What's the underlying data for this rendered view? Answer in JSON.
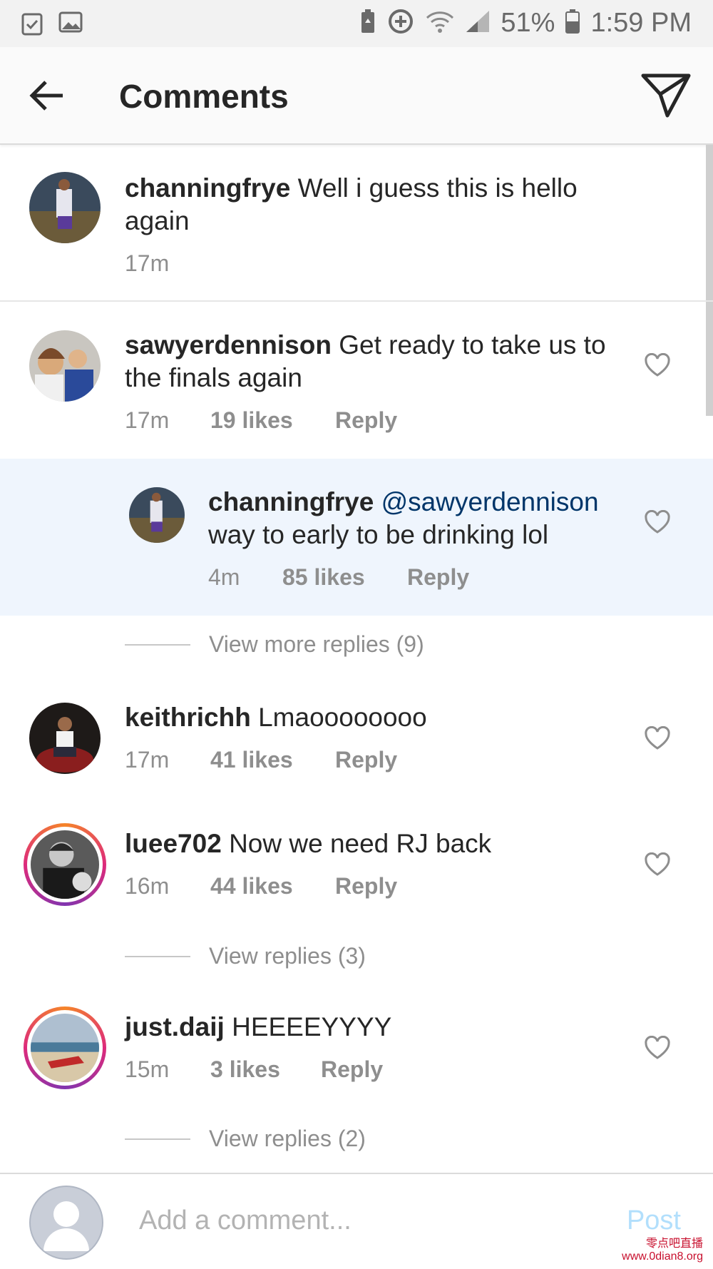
{
  "status_bar": {
    "battery": "51%",
    "time": "1:59 PM"
  },
  "header": {
    "title": "Comments"
  },
  "caption": {
    "user": "channingfrye",
    "text": "Well i guess this is hello again",
    "time": "17m"
  },
  "comments": [
    {
      "user": "sawyerdennison",
      "text": "Get ready to take us to the finals again",
      "time": "17m",
      "likes": "19 likes",
      "reply": "Reply"
    },
    {
      "user": "channingfrye",
      "mention": "@sawyerdennison",
      "text": "way to early to be drinking lol",
      "time": "4m",
      "likes": "85 likes",
      "reply": "Reply"
    },
    {
      "user": "keithrichh",
      "text": "Lmaoooooooo",
      "time": "17m",
      "likes": "41 likes",
      "reply": "Reply"
    },
    {
      "user": "luee702",
      "text": "Now we need RJ back",
      "time": "16m",
      "likes": "44 likes",
      "reply": "Reply"
    },
    {
      "user": "just.daij",
      "text": "HEEEEYYYY",
      "time": "15m",
      "likes": "3 likes",
      "reply": "Reply"
    }
  ],
  "view_more_replies": "View more replies (9)",
  "view_replies_luee": "View replies (3)",
  "view_replies_daij": "View replies (2)",
  "composer": {
    "placeholder": "Add a comment...",
    "post": "Post"
  },
  "watermark": {
    "line1": "零点吧直播",
    "line2": "www.0dian8.org"
  },
  "colors": {
    "accent": "#3897f0",
    "post_disabled": "#b2dffc",
    "highlight": "#eff5fd",
    "mention": "#003569"
  }
}
